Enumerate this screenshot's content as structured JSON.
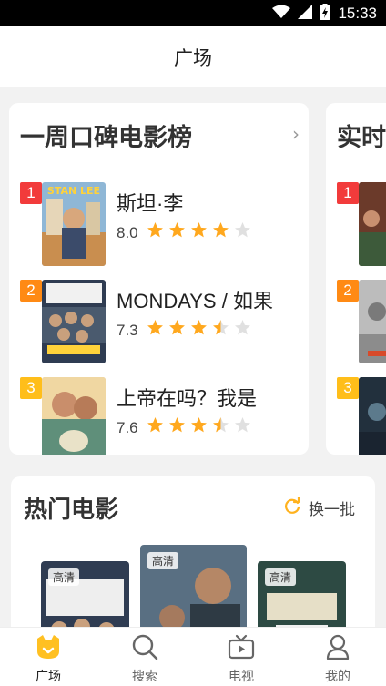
{
  "status_bar": {
    "time": "15:33"
  },
  "header": {
    "title": "广场"
  },
  "rank_cards": [
    {
      "title": "一周口碑电影榜",
      "items": [
        {
          "rank": "1",
          "name": "斯坦·李",
          "score": "8.0",
          "rating": 4.0
        },
        {
          "rank": "2",
          "name": "MONDAYS / 如果",
          "score": "7.3",
          "rating": 3.5
        },
        {
          "rank": "3",
          "name": "上帝在吗？我是",
          "score": "7.6",
          "rating": 3.5
        }
      ]
    },
    {
      "title": "实时",
      "items": [
        {
          "rank": "1"
        },
        {
          "rank": "2"
        },
        {
          "rank": "3"
        }
      ]
    }
  ],
  "hot": {
    "title": "热门电影",
    "refresh_label": "换一批",
    "posters": [
      {
        "tag": "高清"
      },
      {
        "tag": "高清"
      },
      {
        "tag": "高清"
      }
    ]
  },
  "tabs": [
    {
      "label": "广场",
      "icon": "home-icon",
      "active": true
    },
    {
      "label": "搜索",
      "icon": "search-icon",
      "active": false
    },
    {
      "label": "电视",
      "icon": "tv-icon",
      "active": false
    },
    {
      "label": "我的",
      "icon": "profile-icon",
      "active": false
    }
  ],
  "colors": {
    "accent": "#ffc022",
    "star_full": "#ffa81e",
    "star_empty": "#e0e0e0",
    "badge_1": "#f23b3b",
    "badge_2": "#ff8a14",
    "badge_3": "#ffbe1a"
  }
}
